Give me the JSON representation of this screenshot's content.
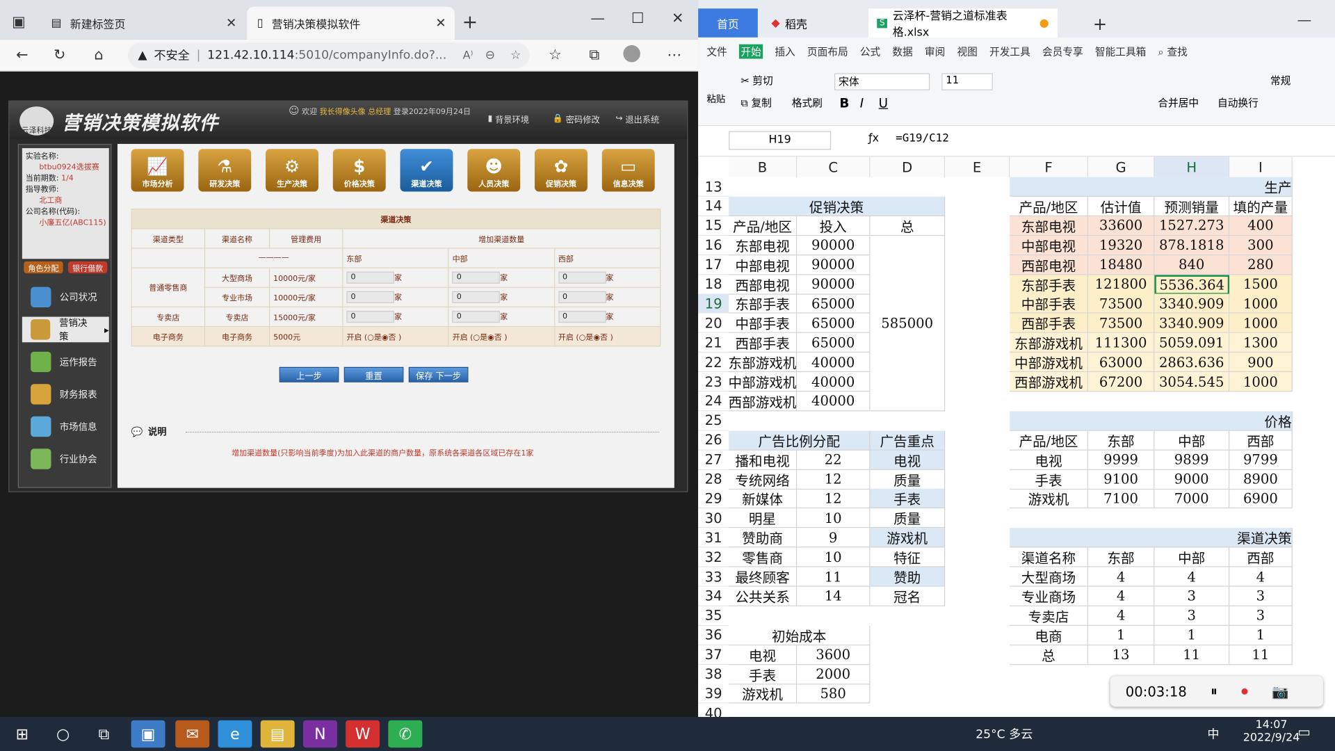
{
  "browser": {
    "tabs": [
      "新建标签页",
      "营销决策模拟软件"
    ],
    "warning": "不安全",
    "url_host": "121.42.10.114",
    "url_rest": ":5010/companyInfo.do?..."
  },
  "app": {
    "title": "营销决策模拟软件",
    "logo_text": "云泽科技",
    "welcome_prefix": "欢迎",
    "welcome_user": "我长得像头像",
    "welcome_role": "总经理",
    "login": "登录2022年09月24日",
    "head_buttons": [
      "背景环境",
      "密码修改",
      "退出系统"
    ],
    "info": [
      {
        "label": "实验名称:",
        "value": "btbu0924选拔赛"
      },
      {
        "label": "当前期数:",
        "value": "1/4"
      },
      {
        "label": "指导教师:",
        "value": "北工商"
      },
      {
        "label": "公司名称(代码):",
        "value": "小廉五亿(ABC115)"
      }
    ],
    "pills": [
      "角色分配",
      "银行借款"
    ],
    "nav": [
      "公司状况",
      "营销决策",
      "运作报告",
      "财务报表",
      "市场信息",
      "行业协会"
    ],
    "top_buttons": [
      "市场分析",
      "研发决策",
      "生产决策",
      "价格决策",
      "渠道决策",
      "人员决策",
      "促销决策",
      "信息决策"
    ],
    "table_title": "渠道决策",
    "headers": [
      "渠道类型",
      "渠道名称",
      "管理费用",
      "增加渠道数量"
    ],
    "regions": [
      "东部",
      "中部",
      "西部"
    ],
    "dash": "————",
    "unit": "家",
    "rows": [
      {
        "type": "普通零售商",
        "name": "大型商场",
        "fee": "10000元/家",
        "vals": [
          "0",
          "0",
          "0"
        ]
      },
      {
        "type": "",
        "name": "专业市场",
        "fee": "10000元/家",
        "vals": [
          "0",
          "0",
          "0"
        ]
      },
      {
        "type": "专卖店",
        "name": "专卖店",
        "fee": "15000元/家",
        "vals": [
          "0",
          "0",
          "0"
        ]
      }
    ],
    "ecom": {
      "type": "电子商务",
      "name": "电子商务",
      "fee": "5000元",
      "toggle": "开启 (○是◉否 )"
    },
    "buttons": [
      "上一步",
      "重置",
      "保存 下一步"
    ],
    "note_title": "说明",
    "note": "增加渠道数量(只影响当前季度)为加入此渠道的商户数量，原系统各渠道各区域已存在1家"
  },
  "excel": {
    "tabs": [
      "首页",
      "稻壳",
      "云泽杯-营销之道标准表格.xlsx"
    ],
    "menu": [
      "文件",
      "开始",
      "插入",
      "页面布局",
      "公式",
      "数据",
      "审阅",
      "视图",
      "开发工具",
      "会员专享",
      "智能工具箱",
      "查找"
    ],
    "ribbon": {
      "cut": "剪切",
      "copy": "复制",
      "paste": "粘贴",
      "format_painter": "格式刷",
      "font": "宋体",
      "size": "11",
      "merge": "合并居中",
      "wrap": "自动换行",
      "numfmt": "常规"
    },
    "cell_ref": "H19",
    "formula": "=G19/C12",
    "cols": [
      "B",
      "C",
      "D",
      "E",
      "F",
      "G",
      "H",
      "I"
    ],
    "rows_nums": [
      "13",
      "14",
      "15",
      "16",
      "17",
      "18",
      "19",
      "20",
      "21",
      "22",
      "23",
      "24",
      "25",
      "26",
      "27",
      "28",
      "29",
      "30",
      "31",
      "32",
      "33",
      "34",
      "35",
      "36",
      "37",
      "38",
      "39",
      "40"
    ],
    "promo_title": "促销决策",
    "promo_head": [
      "产品/地区",
      "投入",
      "总"
    ],
    "promo": [
      [
        "东部电视",
        "90000"
      ],
      [
        "中部电视",
        "90000"
      ],
      [
        "西部电视",
        "90000"
      ],
      [
        "东部手表",
        "65000"
      ],
      [
        "中部手表",
        "65000"
      ],
      [
        "西部手表",
        "65000"
      ],
      [
        "东部游戏机",
        "40000"
      ],
      [
        "中部游戏机",
        "40000"
      ],
      [
        "西部游戏机",
        "40000"
      ]
    ],
    "promo_total": "585000",
    "ad_head": [
      "广告比例分配",
      "广告重点"
    ],
    "ad": [
      [
        "播和电视",
        "22",
        "电视"
      ],
      [
        "专统网络",
        "12",
        "质量"
      ],
      [
        "新媒体",
        "12",
        "手表"
      ],
      [
        "明星",
        "10",
        "质量"
      ],
      [
        "赞助商",
        "9",
        "游戏机"
      ],
      [
        "零售商",
        "10",
        "特征"
      ],
      [
        "最终顾客",
        "11",
        "赞助"
      ],
      [
        "公共关系",
        "14",
        "冠名"
      ]
    ],
    "cost_head": "初始成本",
    "cost": [
      [
        "电视",
        "3600"
      ],
      [
        "手表",
        "2000"
      ],
      [
        "游戏机",
        "580"
      ]
    ],
    "prod_title": "生产",
    "prod_head": [
      "产品/地区",
      "估计值",
      "预测销量",
      "填的产量"
    ],
    "prod": [
      [
        "东部电视",
        "33600",
        "1527.273",
        "400"
      ],
      [
        "中部电视",
        "19320",
        "878.1818",
        "300"
      ],
      [
        "西部电视",
        "18480",
        "840",
        "280"
      ],
      [
        "东部手表",
        "121800",
        "5536.364",
        "1500"
      ],
      [
        "中部手表",
        "73500",
        "3340.909",
        "1000"
      ],
      [
        "西部手表",
        "73500",
        "3340.909",
        "1000"
      ],
      [
        "东部游戏机",
        "111300",
        "5059.091",
        "1300"
      ],
      [
        "中部游戏机",
        "63000",
        "2863.636",
        "900"
      ],
      [
        "西部游戏机",
        "67200",
        "3054.545",
        "1000"
      ]
    ],
    "price_title": "价格",
    "price_head": [
      "产品/地区",
      "东部",
      "中部",
      "西部"
    ],
    "price": [
      [
        "电视",
        "9999",
        "9899",
        "9799"
      ],
      [
        "手表",
        "9100",
        "9000",
        "8900"
      ],
      [
        "游戏机",
        "7100",
        "7000",
        "6900"
      ]
    ],
    "chan_title": "渠道决策",
    "chan_head": [
      "渠道名称",
      "东部",
      "中部",
      "西部"
    ],
    "chan": [
      [
        "大型商场",
        "4",
        "4",
        "4"
      ],
      [
        "专业商场",
        "4",
        "3",
        "3"
      ],
      [
        "专卖店",
        "4",
        "3",
        "3"
      ],
      [
        "电商",
        "1",
        "1",
        "1"
      ],
      [
        "总",
        "13",
        "11",
        "11"
      ]
    ],
    "recorder": "00:03:18"
  },
  "taskbar": {
    "weather": "25°C 多云",
    "ime": "中",
    "time": "14:07",
    "date": "2022/9/24"
  }
}
